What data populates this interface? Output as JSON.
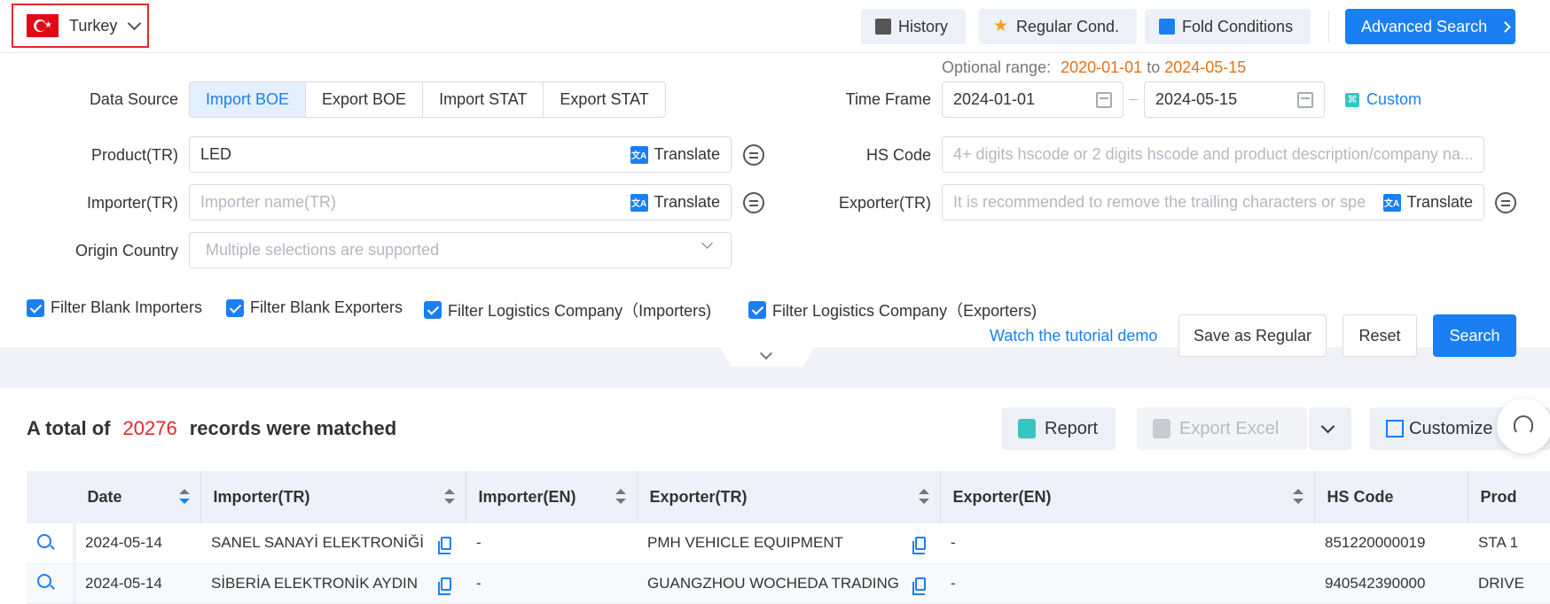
{
  "topbar": {
    "country": "Turkey",
    "history": "History",
    "regular_cond": "Regular Cond.",
    "fold_conditions": "Fold Conditions",
    "advanced_search": "Advanced Search"
  },
  "form": {
    "data_source_label": "Data Source",
    "data_source_options": [
      "Import BOE",
      "Export BOE",
      "Import STAT",
      "Export STAT"
    ],
    "data_source_selected": "Import BOE",
    "optional_range_label": "Optional range:",
    "optional_range_from": "2020-01-01",
    "optional_range_to_word": "to",
    "optional_range_to": "2024-05-15",
    "time_frame_label": "Time Frame",
    "time_from": "2024-01-01",
    "time_to": "2024-05-15",
    "custom": "Custom",
    "product_label": "Product(TR)",
    "product_value": "LED",
    "translate": "Translate",
    "hs_code_label": "HS Code",
    "hs_code_placeholder": "4+ digits hscode or 2 digits hscode and product description/company na...",
    "importer_label": "Importer(TR)",
    "importer_placeholder": "Importer name(TR)",
    "exporter_label": "Exporter(TR)",
    "exporter_placeholder": "It is recommended to remove the trailing characters or spe",
    "origin_label": "Origin Country",
    "origin_placeholder": "Multiple selections are supported",
    "filters": [
      "Filter Blank Importers",
      "Filter Blank Exporters",
      "Filter Logistics Company（Importers)",
      "Filter Logistics Company（Exporters)"
    ],
    "tutorial": "Watch the tutorial demo",
    "save_regular": "Save as Regular",
    "reset": "Reset",
    "search": "Search"
  },
  "results": {
    "prefix": "A total of",
    "count": "20276",
    "suffix": "records were matched",
    "report": "Report",
    "export_excel": "Export Excel",
    "customize": "Customize",
    "columns": [
      "Date",
      "Importer(TR)",
      "Importer(EN)",
      "Exporter(TR)",
      "Exporter(EN)",
      "HS Code",
      "Prod"
    ],
    "rows": [
      {
        "date": "2024-05-14",
        "importer_tr": "SANEL SANAYİ ELEKTRONİĞİ",
        "importer_en": "-",
        "exporter_tr": "PMH VEHICLE EQUIPMENT",
        "exporter_en": "-",
        "hs": "851220000019",
        "prod": "STA 1"
      },
      {
        "date": "2024-05-14",
        "importer_tr": "SİBERİA ELEKTRONİK AYDIN",
        "importer_en": "-",
        "exporter_tr": "GUANGZHOU WOCHEDA TRADING",
        "exporter_en": "-",
        "hs": "940542390000",
        "prod": "DRIVE"
      }
    ]
  },
  "colors": {
    "accent": "#1a7ff3",
    "highlight": "#e0292b",
    "orange": "#e0731a"
  }
}
